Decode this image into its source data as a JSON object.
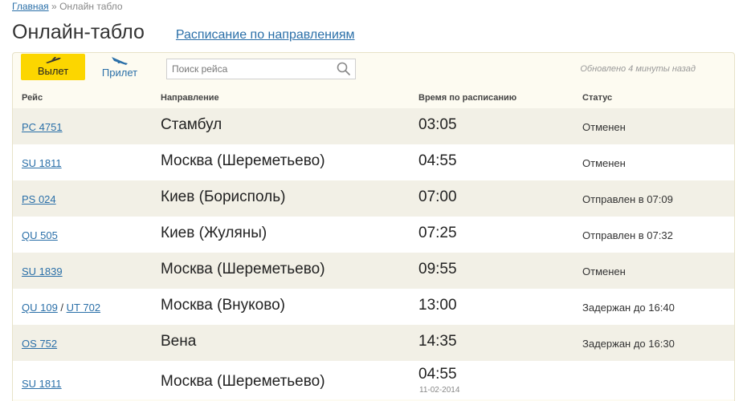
{
  "breadcrumb": {
    "home": "Главная",
    "separator": "»",
    "current": "Онлайн табло"
  },
  "header": {
    "title": "Онлайн-табло",
    "schedule_link": "Расписание по направлениям"
  },
  "tabs": {
    "departure": "Вылет",
    "arrival": "Прилет"
  },
  "search": {
    "placeholder": "Поиск рейса"
  },
  "updated": "Обновлено 4 минуты назад",
  "columns": {
    "flight": "Рейс",
    "direction": "Направление",
    "time": "Время по расписанию",
    "status": "Статус"
  },
  "rows": [
    {
      "flight": "PC 4751",
      "dest": "Стамбул",
      "time": "03:05",
      "status": "Отменен"
    },
    {
      "flight": "SU 1811",
      "dest": "Москва (Шереметьево)",
      "time": "04:55",
      "status": "Отменен"
    },
    {
      "flight": "PS 024",
      "dest": "Киев (Борисполь)",
      "time": "07:00",
      "status": "Отправлен в 07:09"
    },
    {
      "flight": "QU 505",
      "dest": "Киев (Жуляны)",
      "time": "07:25",
      "status": "Отправлен в 07:32"
    },
    {
      "flight": "SU 1839",
      "dest": "Москва (Шереметьево)",
      "time": "09:55",
      "status": "Отменен"
    },
    {
      "flight": "QU 109",
      "flight2": "UT 702",
      "dest": "Москва (Внуково)",
      "time": "13:00",
      "status": "Задержан до 16:40"
    },
    {
      "flight": "OS 752",
      "dest": "Вена",
      "time": "14:35",
      "status": "Задержан до 16:30"
    },
    {
      "flight": "SU 1811",
      "dest": "Москва (Шереметьево)",
      "time": "04:55",
      "date": "11-02-2014",
      "status": ""
    }
  ],
  "colors": {
    "accent": "#fcd600",
    "link": "#2a6fa8",
    "row_alt": "#f2f0e6",
    "panel": "#fdfbf1"
  }
}
